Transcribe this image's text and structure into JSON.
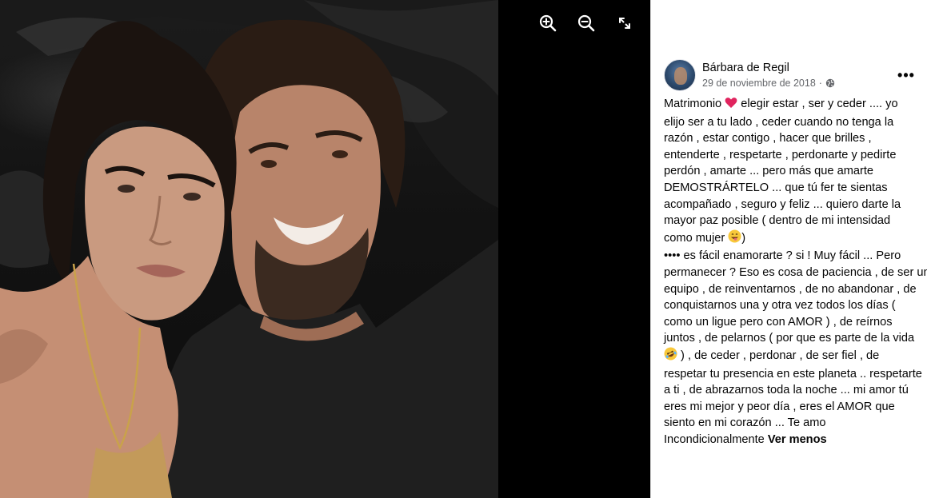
{
  "viewer": {
    "tools": [
      {
        "icon": "zoom-in-icon"
      },
      {
        "icon": "zoom-out-icon"
      },
      {
        "icon": "fullscreen-icon"
      }
    ]
  },
  "post": {
    "author": "Bárbara de Regil",
    "date": "29 de noviembre de 2018",
    "separator": "·",
    "privacy_icon": "globe-icon",
    "more_label": "•••",
    "lines": [
      [
        "Matrimonio ",
        "{heart}",
        " elegir estar , ser y ceder .... yo"
      ],
      [
        "elijo ser a tu lado , ceder cuando no tenga la"
      ],
      [
        "razón , estar contigo , hacer que brilles ,"
      ],
      [
        "entenderte , respetarte , perdonarte y pedirte"
      ],
      [
        "perdón , amarte ... pero más que amarte"
      ],
      [
        "DEMOSTRÁRTELO ... que tú fer te sientas"
      ],
      [
        "acompañado , seguro y feliz ... quiero darte la"
      ],
      [
        "mayor paz posible ( dentro de mi intensidad"
      ],
      [
        "como mujer ",
        "{grin}",
        ")"
      ],
      [
        "•••• es fácil enamorarte ? si ! Muy fácil ... Pero"
      ],
      [
        "permanecer ? Eso es cosa de paciencia , de ser un"
      ],
      [
        "equipo , de reinventarnos , de no abandonar , de"
      ],
      [
        "conquistarnos una y otra vez todos los días ("
      ],
      [
        "como un ligue pero con AMOR ) , de reírnos"
      ],
      [
        "juntos , de pelarnos ( por que es parte de la vida"
      ],
      [
        "{laugh}",
        " ) , de ceder , perdonar , de ser fiel , de"
      ],
      [
        "respetar tu presencia en este planeta .. respetarte"
      ],
      [
        "a ti , de abrazarnos toda la noche ... mi amor tú"
      ],
      [
        "eres mi mejor y peor día , eres el AMOR que"
      ],
      [
        "siento en mi corazón ... Te amo"
      ],
      [
        "Incondicionalmente "
      ]
    ],
    "see_less": "Ver menos",
    "emojis": {
      "heart": "red-heart-emoji",
      "grin": "grinning-tongue-emoji",
      "laugh": "rolling-laughing-emoji"
    }
  },
  "colors": {
    "accent_text": "#050505",
    "meta_text": "#65676b",
    "viewer_bg": "#000000",
    "panel_bg": "#ffffff"
  }
}
